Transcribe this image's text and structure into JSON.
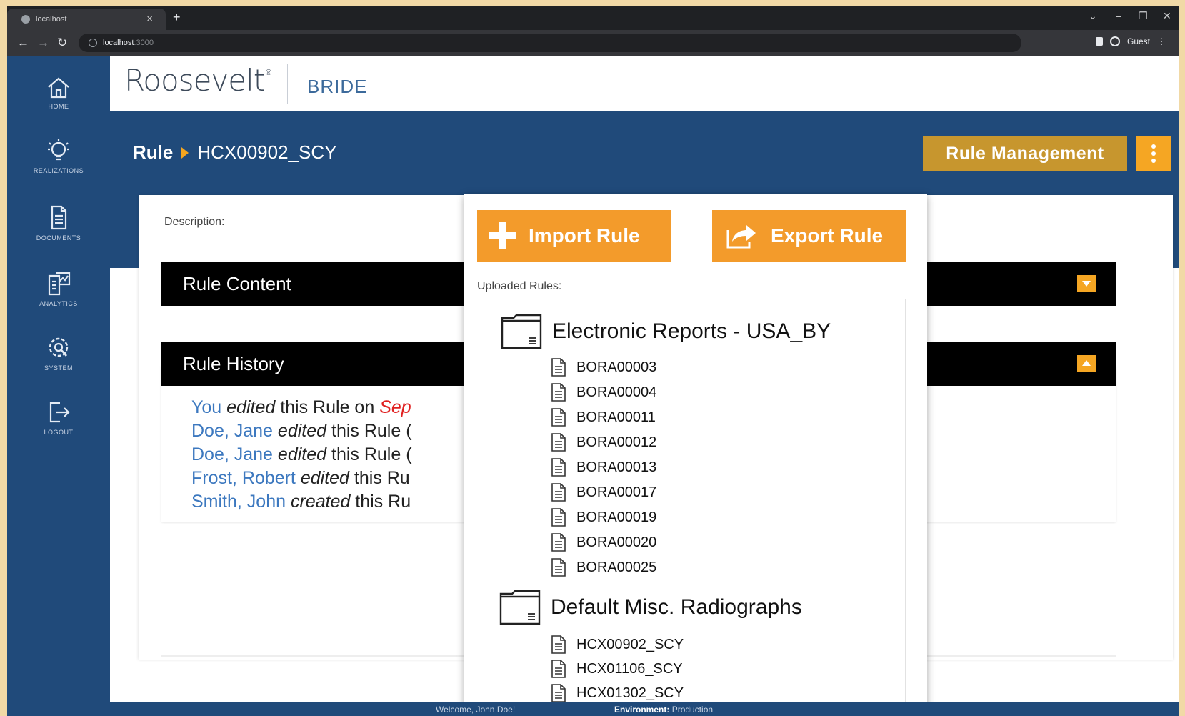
{
  "browser": {
    "tab_title": "localhost",
    "new_tab": "+",
    "close_tab": "×",
    "url_host": "localhost",
    "url_port": ":3000",
    "profile_label": "Guest"
  },
  "sidebar": {
    "items": [
      {
        "label": "HOME"
      },
      {
        "label": "REALIZATIONS"
      },
      {
        "label": "DOCUMENTS"
      },
      {
        "label": "ANALYTICS"
      },
      {
        "label": "SYSTEM"
      },
      {
        "label": "LOGOUT"
      }
    ]
  },
  "header": {
    "logo": "Roosevelt",
    "logo_mark": "®",
    "product": "BRIDE"
  },
  "breadcrumb": {
    "section": "Rule",
    "current": "HCX00902_SCY"
  },
  "actions": {
    "rule_management": "Rule Management"
  },
  "rule": {
    "description_label": "Description:",
    "content_title": "Rule Content",
    "history_title": "Rule History",
    "history": [
      {
        "who": "You",
        "verb": "edited",
        "rest": " this Rule on ",
        "date": "Sep"
      },
      {
        "who": "Doe, Jane",
        "verb": "edited",
        "rest": " this Rule ("
      },
      {
        "who": "Doe, Jane",
        "verb": "edited",
        "rest": " this Rule ("
      },
      {
        "who": "Frost, Robert",
        "verb": "edited",
        "rest": " this Ru"
      },
      {
        "who": "Smith, John",
        "verb": "created",
        "rest": " this Ru"
      }
    ]
  },
  "panel": {
    "import_label": "Import Rule",
    "export_label": "Export Rule",
    "uploaded_label": "Uploaded Rules:",
    "folders": [
      {
        "name": "Electronic Reports - USA_BY",
        "files": [
          "BORA00003",
          "BORA00004",
          "BORA00011",
          "BORA00012",
          "BORA00013",
          "BORA00017",
          "BORA00019",
          "BORA00020",
          "BORA00025"
        ]
      },
      {
        "name": "Default Misc. Radiographs",
        "files": [
          "HCX00902_SCY",
          "HCX01106_SCY",
          "HCX01302_SCY"
        ]
      }
    ]
  },
  "status": {
    "welcome": "Welcome, John Doe!",
    "env_label": "Environment:",
    "env_value": "Production"
  }
}
